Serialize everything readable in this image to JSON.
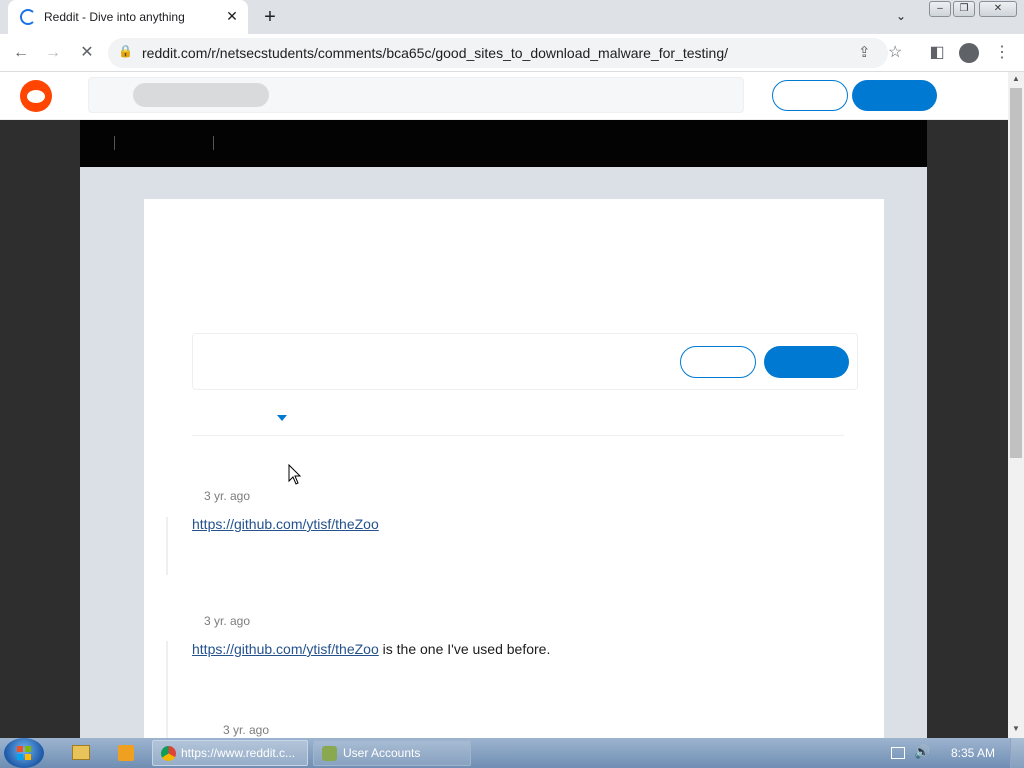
{
  "browser": {
    "tab_title": "Reddit - Dive into anything",
    "url": "reddit.com/r/netsecstudents/comments/bca65c/good_sites_to_download_malware_for_testing/"
  },
  "comments": [
    {
      "timestamp": "3 yr. ago",
      "link": "https://github.com/ytisf/theZoo",
      "text_after": ""
    },
    {
      "timestamp": "3 yr. ago",
      "link": "https://github.com/ytisf/theZoo",
      "text_after": " is the one I've used before."
    },
    {
      "timestamp": "3 yr. ago"
    }
  ],
  "taskbar": {
    "chrome_task": "https://www.reddit.c...",
    "users_task": "User Accounts",
    "clock": "8:35 AM"
  },
  "colors": {
    "reddit_orange": "#ff4500",
    "reddit_blue": "#0079d3"
  },
  "icons": [
    "reload-stop-icon",
    "lock-icon",
    "share-icon",
    "star-icon",
    "sidepanel-icon",
    "profile-icon",
    "menu-icon",
    "start-orb-icon",
    "explorer-icon",
    "media-player-icon",
    "chrome-icon",
    "user-accounts-icon",
    "network-icon",
    "volume-icon"
  ]
}
